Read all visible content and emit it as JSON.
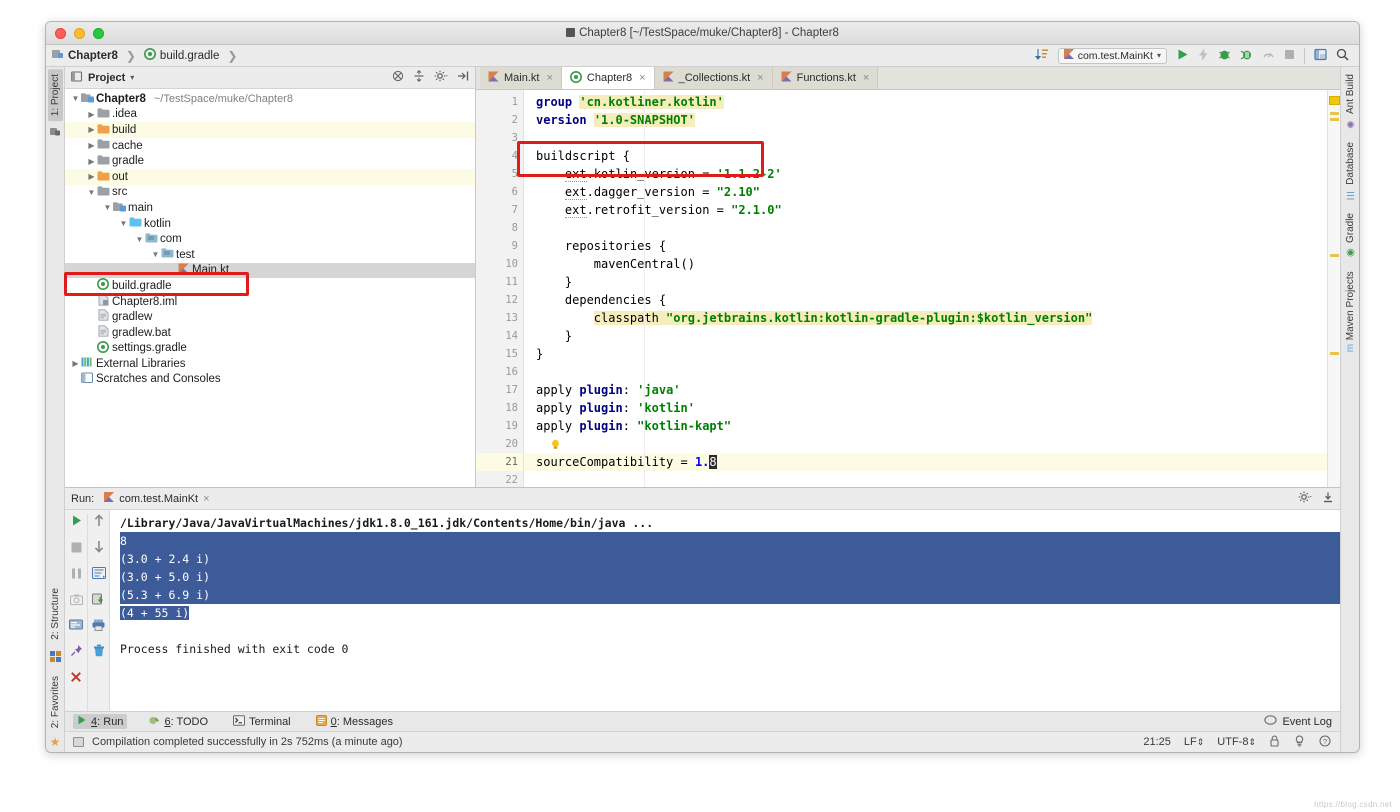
{
  "window": {
    "title": "Chapter8 [~/TestSpace/muke/Chapter8] - Chapter8"
  },
  "breadcrumb": {
    "items": [
      {
        "label": "Chapter8",
        "icon": "module-icon"
      },
      {
        "label": "build.gradle",
        "icon": "gradle-icon"
      }
    ],
    "separator": "❯"
  },
  "toolbar": {
    "run_config": "com.test.MainKt",
    "icons": [
      "sort-icon",
      "run-icon",
      "build-icon",
      "debug-icon",
      "coverage-icon",
      "profile-icon",
      "stop-icon",
      "layout-icon",
      "search-icon"
    ],
    "dropdown_caret": "▾"
  },
  "left_rail": {
    "top": [
      {
        "label": "1: Project",
        "active": true
      }
    ],
    "bottom": [
      {
        "label": "2: Structure",
        "active": false
      },
      {
        "label": "2: Favorites",
        "active": false
      }
    ]
  },
  "right_rail": {
    "items": [
      {
        "label": "Ant Build",
        "icon": "ant-icon"
      },
      {
        "label": "Database",
        "icon": "database-icon"
      },
      {
        "label": "Gradle",
        "icon": "gradle-icon"
      },
      {
        "label": "Maven Projects",
        "icon": "maven-icon"
      }
    ]
  },
  "project_panel": {
    "title": "Project",
    "dropdown_caret": "▾",
    "actions": [
      "collapse-all-icon",
      "expand-all-icon",
      "settings-icon",
      "hide-icon"
    ],
    "tree": [
      {
        "indent": 0,
        "arrow": "▼",
        "icon": "module-folder",
        "label": "Chapter8",
        "bold": true,
        "path": "~/TestSpace/muke/Chapter8",
        "state": "normal"
      },
      {
        "indent": 1,
        "arrow": "▶",
        "icon": "folder-gray",
        "label": ".idea",
        "state": "normal"
      },
      {
        "indent": 1,
        "arrow": "▶",
        "icon": "folder-orange",
        "label": "build",
        "state": "excluded"
      },
      {
        "indent": 1,
        "arrow": "▶",
        "icon": "folder-gray",
        "label": "cache",
        "state": "normal"
      },
      {
        "indent": 1,
        "arrow": "▶",
        "icon": "folder-gray",
        "label": "gradle",
        "state": "normal"
      },
      {
        "indent": 1,
        "arrow": "▶",
        "icon": "folder-orange",
        "label": "out",
        "state": "excluded"
      },
      {
        "indent": 1,
        "arrow": "▼",
        "icon": "folder-gray",
        "label": "src",
        "state": "normal"
      },
      {
        "indent": 2,
        "arrow": "▼",
        "icon": "module-folder",
        "label": "main",
        "state": "normal"
      },
      {
        "indent": 3,
        "arrow": "▼",
        "icon": "folder-source",
        "label": "kotlin",
        "state": "source"
      },
      {
        "indent": 4,
        "arrow": "▼",
        "icon": "package-icon",
        "label": "com",
        "state": "normal"
      },
      {
        "indent": 5,
        "arrow": "▼",
        "icon": "package-icon",
        "label": "test",
        "state": "normal"
      },
      {
        "indent": 6,
        "arrow": "",
        "icon": "kotlin-file-icon",
        "label": "Main.kt",
        "state": "selected"
      },
      {
        "indent": 1,
        "arrow": "",
        "icon": "gradle-icon",
        "label": "build.gradle",
        "state": "normal"
      },
      {
        "indent": 1,
        "arrow": "",
        "icon": "iml-icon",
        "label": "Chapter8.iml",
        "state": "normal"
      },
      {
        "indent": 1,
        "arrow": "",
        "icon": "file-icon",
        "label": "gradlew",
        "state": "normal"
      },
      {
        "indent": 1,
        "arrow": "",
        "icon": "file-icon",
        "label": "gradlew.bat",
        "state": "normal"
      },
      {
        "indent": 1,
        "arrow": "",
        "icon": "gradle-icon",
        "label": "settings.gradle",
        "state": "normal"
      },
      {
        "indent": 0,
        "arrow": "▶",
        "icon": "libraries-icon",
        "label": "External Libraries",
        "state": "normal"
      },
      {
        "indent": 0,
        "arrow": "",
        "icon": "scratches-icon",
        "label": "Scratches and Consoles",
        "state": "normal"
      }
    ]
  },
  "editor": {
    "tabs": [
      {
        "label": "Main.kt",
        "icon": "kotlin-file-icon",
        "active": false,
        "close": "×"
      },
      {
        "label": "Chapter8",
        "icon": "gradle-icon",
        "active": true,
        "close": "×"
      },
      {
        "label": "_Collections.kt",
        "icon": "kotlin-file-icon",
        "active": false,
        "close": "×"
      },
      {
        "label": "Functions.kt",
        "icon": "kotlin-file-icon",
        "active": false,
        "close": "×"
      }
    ],
    "line_numbers": [
      1,
      2,
      3,
      4,
      5,
      6,
      7,
      8,
      9,
      10,
      11,
      12,
      13,
      14,
      15,
      16,
      17,
      18,
      19,
      20,
      21,
      22
    ],
    "current_line": 21,
    "lines": [
      {
        "n": 1,
        "text": "group 'cn.kotliner.kotlin'"
      },
      {
        "n": 2,
        "text": "version '1.0-SNAPSHOT'"
      },
      {
        "n": 3,
        "text": ""
      },
      {
        "n": 4,
        "text": "buildscript {",
        "fold": "⊖"
      },
      {
        "n": 5,
        "text": "    ext.kotlin_version = '1.1.2-2'"
      },
      {
        "n": 6,
        "text": "    ext.dagger_version = \"2.10\""
      },
      {
        "n": 7,
        "text": "    ext.retrofit_version = \"2.1.0\""
      },
      {
        "n": 8,
        "text": ""
      },
      {
        "n": 9,
        "text": "    repositories {",
        "fold": "⊖"
      },
      {
        "n": 10,
        "text": "        mavenCentral()"
      },
      {
        "n": 11,
        "text": "    }",
        "fold": "⊕"
      },
      {
        "n": 12,
        "text": "    dependencies {",
        "fold": "⊖"
      },
      {
        "n": 13,
        "text": "        classpath \"org.jetbrains.kotlin:kotlin-gradle-plugin:$kotlin_version\""
      },
      {
        "n": 14,
        "text": "    }",
        "fold": "⊕"
      },
      {
        "n": 15,
        "text": "}",
        "fold": "⊕"
      },
      {
        "n": 16,
        "text": ""
      },
      {
        "n": 17,
        "text": "apply plugin: 'java'"
      },
      {
        "n": 18,
        "text": "apply plugin: 'kotlin'"
      },
      {
        "n": 19,
        "text": "apply plugin: \"kotlin-kapt\""
      },
      {
        "n": 20,
        "text": "",
        "icon": "lightbulb-icon"
      },
      {
        "n": 21,
        "text": "sourceCompatibility = 1.8"
      },
      {
        "n": 22,
        "text": ""
      }
    ]
  },
  "run_panel": {
    "label": "Run:",
    "tab": "com.test.MainKt",
    "tab_close": "×",
    "actions": [
      "settings-icon",
      "hide-icon"
    ],
    "left_tools": [
      "rerun-icon",
      "stop-icon",
      "pause-icon",
      "camera-icon",
      "console-icon",
      "pin-icon",
      "close-icon"
    ],
    "right_tools": [
      "up-icon",
      "down-icon",
      "soft-wrap-icon",
      "export-icon",
      "print-icon",
      "trash-icon"
    ],
    "console": [
      {
        "text": "/Library/Java/JavaVirtualMachines/jdk1.8.0_161.jdk/Contents/Home/bin/java ...",
        "style": "link"
      },
      {
        "text": "8",
        "style": "selected"
      },
      {
        "text": "(3.0 + 2.4 i)",
        "style": "selected"
      },
      {
        "text": "(3.0 + 5.0 i)",
        "style": "selected"
      },
      {
        "text": "(5.3 + 6.9 i)",
        "style": "selected"
      },
      {
        "text": "(4 + 55 i)",
        "style": "selected-partial"
      },
      {
        "text": "",
        "style": "plain"
      },
      {
        "text": "Process finished with exit code 0",
        "style": "plain"
      }
    ]
  },
  "tool_window_bar": {
    "items": [
      {
        "num": "4",
        "label": "Run",
        "icon": "run-icon",
        "active": true
      },
      {
        "num": "6",
        "label": "TODO",
        "icon": "todo-icon",
        "active": false
      },
      {
        "num": "",
        "label": "Terminal",
        "icon": "terminal-icon",
        "active": false
      },
      {
        "num": "0",
        "label": "Messages",
        "icon": "messages-icon",
        "active": false
      }
    ],
    "event_log": "Event Log",
    "event_log_icon": "balloon-icon"
  },
  "statusbar": {
    "message": "Compilation completed successfully in 2s 752ms (a minute ago)",
    "time": "21:25",
    "line_separator": "LF",
    "encoding": "UTF-8",
    "updown": "⇕",
    "icons": [
      "lock-icon",
      "inspections-icon",
      "help-icon"
    ]
  },
  "colors": {
    "accent_red": "#e01b1b",
    "selection_blue": "#3d5b99",
    "current_line": "#fcfbe3",
    "string_green": "#008000",
    "keyword_navy": "#000080"
  },
  "watermark": "https://blog.csdn.net"
}
